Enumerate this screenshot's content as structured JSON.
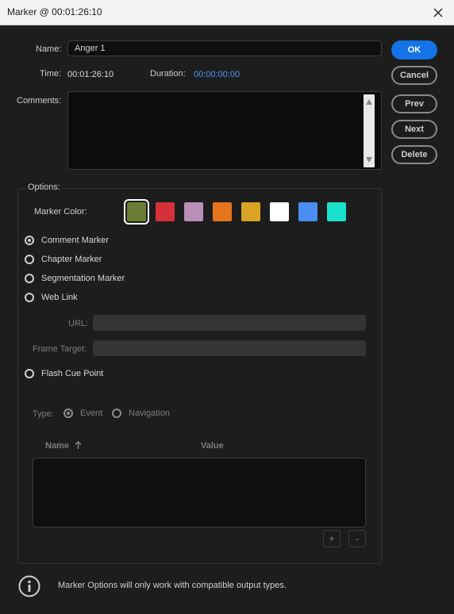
{
  "window": {
    "title": "Marker @ 00:01:26:10"
  },
  "fields": {
    "name_label": "Name:",
    "name_value": "Anger 1",
    "time_label": "Time:",
    "time_value": "00:01:26:10",
    "duration_label": "Duration:",
    "duration_value": "00:00:00:00",
    "comments_label": "Comments:"
  },
  "buttons": {
    "ok": "OK",
    "cancel": "Cancel",
    "prev": "Prev",
    "next": "Next",
    "delete": "Delete"
  },
  "options": {
    "label": "Options:",
    "marker_color_label": "Marker Color:",
    "colors": [
      "#6b7d34",
      "#d6303a",
      "#b98eb8",
      "#e8741d",
      "#d9a325",
      "#ffffff",
      "#4a8df3",
      "#19e0c8"
    ],
    "selected_color_index": 0,
    "types": [
      {
        "label": "Comment Marker",
        "checked": true
      },
      {
        "label": "Chapter Marker",
        "checked": false
      },
      {
        "label": "Segmentation Marker",
        "checked": false
      },
      {
        "label": "Web Link",
        "checked": false
      }
    ],
    "url_label": "URL:",
    "frame_target_label": "Frame Target:",
    "flash_cue_point_label": "Flash Cue Point"
  },
  "cue": {
    "type_label": "Type:",
    "event_label": "Event",
    "navigation_label": "Navigation",
    "columns": {
      "name": "Name",
      "value": "Value"
    },
    "add": "+",
    "remove": "-"
  },
  "footer": {
    "note": "Marker Options will only work with compatible output types."
  }
}
